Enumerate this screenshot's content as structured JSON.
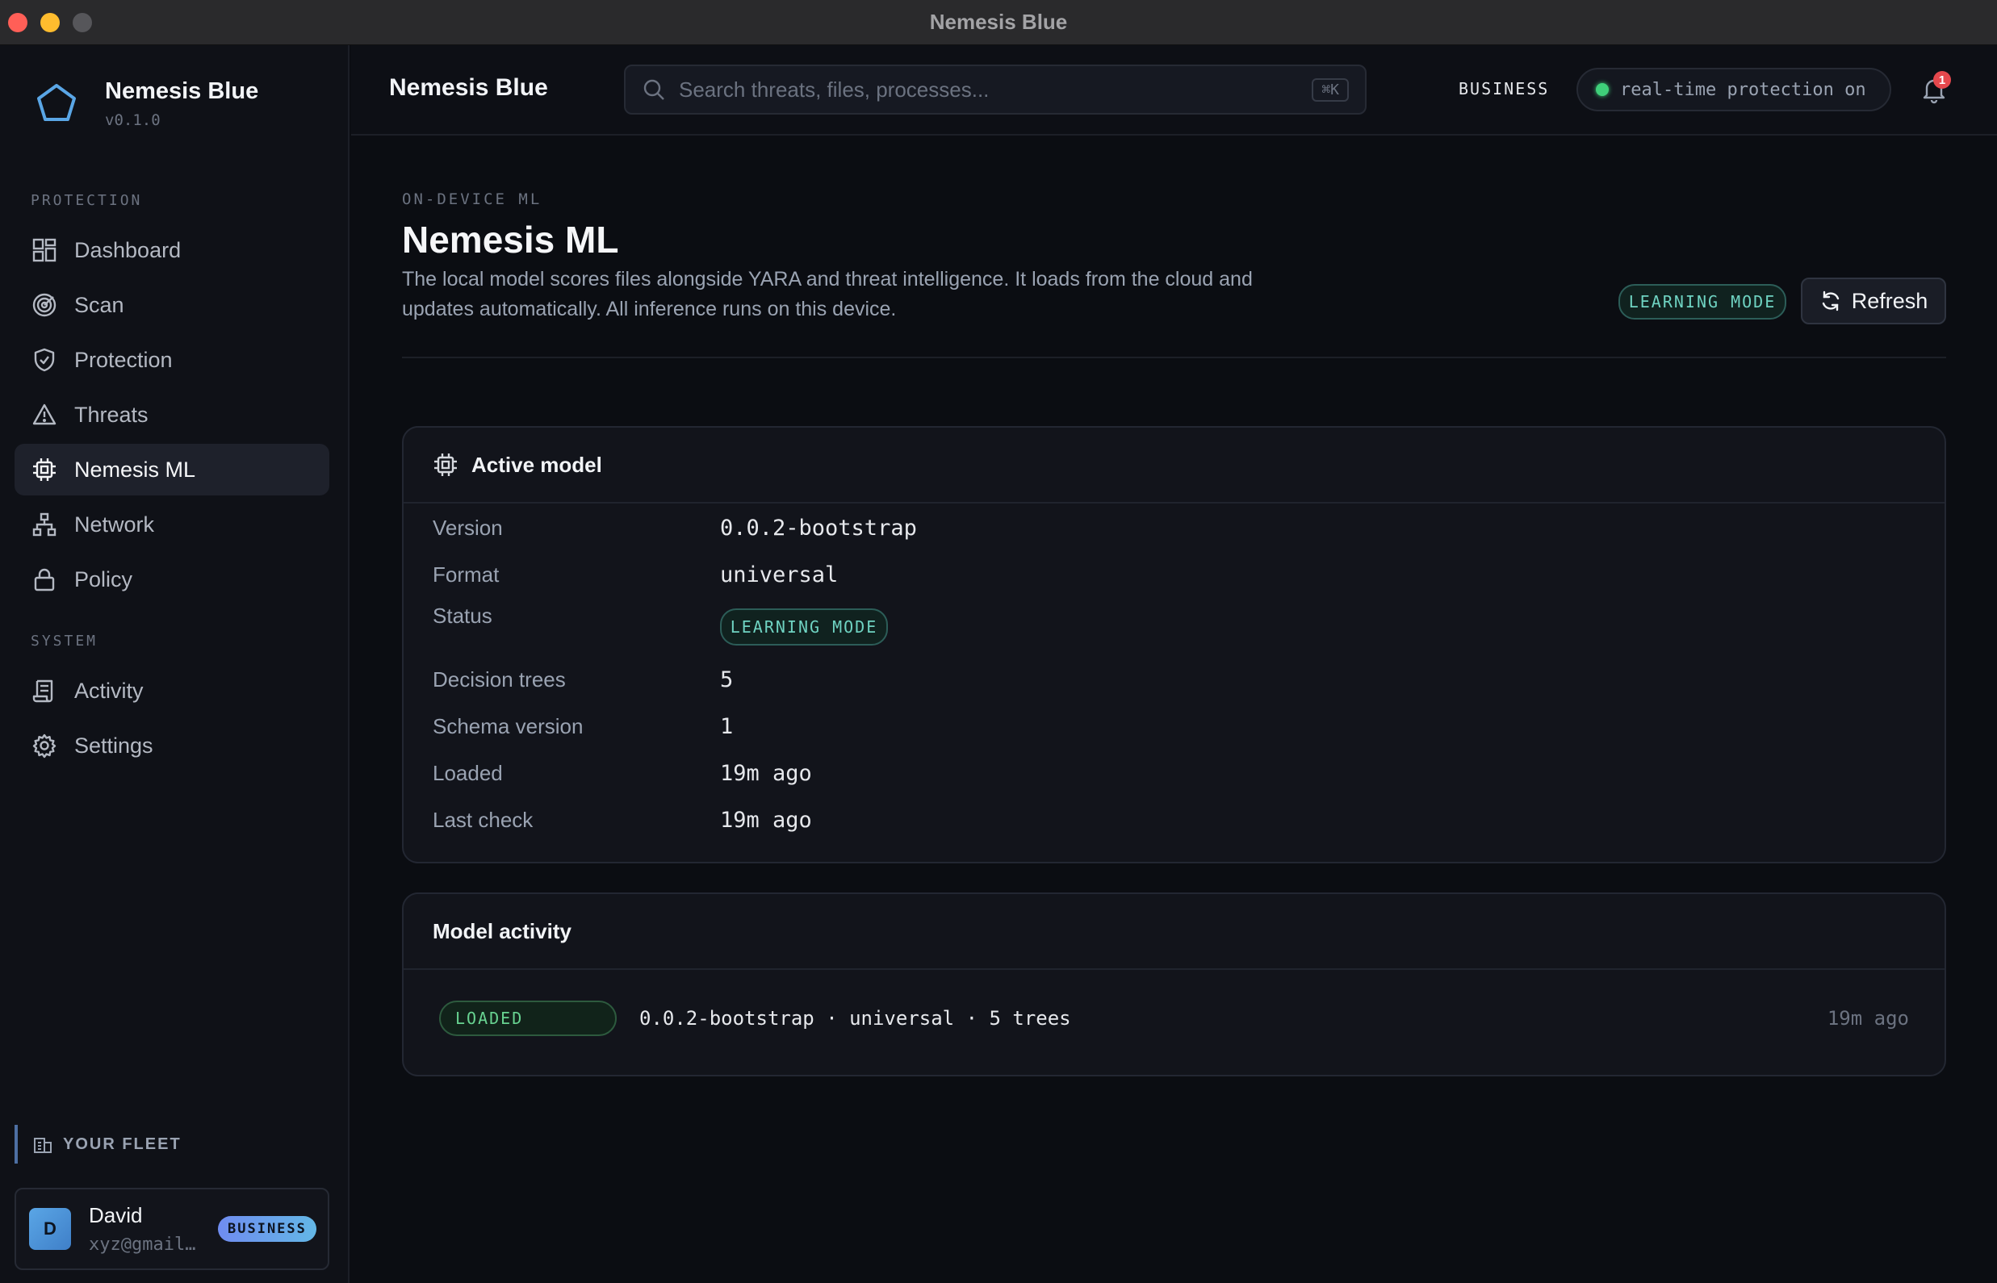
{
  "window": {
    "title": "Nemesis Blue"
  },
  "sidebar": {
    "app_name": "Nemesis Blue",
    "version": "v0.1.0",
    "sections": {
      "protection": "PROTECTION",
      "system": "SYSTEM"
    },
    "items": [
      {
        "label": "Dashboard",
        "icon": "dashboard-grid-icon"
      },
      {
        "label": "Scan",
        "icon": "scan-radar-icon"
      },
      {
        "label": "Protection",
        "icon": "shield-check-icon"
      },
      {
        "label": "Threats",
        "icon": "warning-triangle-icon"
      },
      {
        "label": "Nemesis ML",
        "icon": "cpu-chip-icon",
        "active": true
      },
      {
        "label": "Network",
        "icon": "network-tree-icon"
      },
      {
        "label": "Policy",
        "icon": "lock-icon"
      },
      {
        "label": "Activity",
        "icon": "scroll-log-icon"
      },
      {
        "label": "Settings",
        "icon": "gear-icon"
      }
    ],
    "fleet_label": "YOUR FLEET",
    "user": {
      "initial": "D",
      "name": "David",
      "email": "xyz@gmail…",
      "plan": "BUSINESS"
    }
  },
  "header": {
    "title": "Nemesis Blue",
    "search_placeholder": "Search threats, files, processes...",
    "search_shortcut": "⌘K",
    "plan": "BUSINESS",
    "protection_status": "real-time protection on",
    "notification_count": "1"
  },
  "page": {
    "eyebrow": "ON-DEVICE ML",
    "title": "Nemesis ML",
    "description": "The local model scores files alongside YARA and threat intelligence. It loads from the cloud and updates automatically. All inference runs on this device.",
    "mode_badge": "LEARNING MODE",
    "refresh_label": "Refresh"
  },
  "active_model": {
    "title": "Active model",
    "rows": [
      {
        "label": "Version",
        "value": "0.0.2-bootstrap"
      },
      {
        "label": "Format",
        "value": "universal"
      },
      {
        "label": "Status",
        "value": "LEARNING MODE"
      },
      {
        "label": "Decision trees",
        "value": "5"
      },
      {
        "label": "Schema version",
        "value": "1"
      },
      {
        "label": "Loaded",
        "value": "19m ago"
      },
      {
        "label": "Last check",
        "value": "19m ago"
      }
    ]
  },
  "model_activity": {
    "title": "Model activity",
    "events": [
      {
        "badge": "LOADED",
        "description": "0.0.2-bootstrap · universal · 5 trees",
        "time": "19m ago"
      }
    ]
  },
  "colors": {
    "accent": "#5aa6e6",
    "success": "#3fd07a",
    "teal": "#6fd3c2",
    "danger": "#e5484d"
  }
}
